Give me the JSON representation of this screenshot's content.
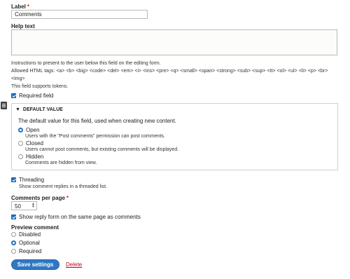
{
  "label_field": {
    "label": "Label",
    "required_marker": "*",
    "value": "Comments"
  },
  "help_text": {
    "label": "Help text",
    "description": "Instructions to present to the user below this field on the editing form.",
    "allowed_tags_line1": "Allowed HTML tags: <a> <b> <big> <code> <del> <em> <i> <ins> <pre> <q> <small> <span> <strong> <sub> <sup> <tt> <ol> <ul> <li> <p> <br>",
    "allowed_tags_line2": "<img>",
    "tokens_note": "This field supports tokens."
  },
  "required_field": {
    "label": "Required field",
    "checked": true
  },
  "default_value": {
    "title": "DEFAULT VALUE",
    "toggle_symbol": "▼",
    "intro": "The default value for this field, used when creating new content.",
    "options": [
      {
        "label": "Open",
        "description": "Users with the \"Post comments\" permission can post comments.",
        "selected": true
      },
      {
        "label": "Closed",
        "description": "Users cannot post comments, but existing comments will be displayed.",
        "selected": false
      },
      {
        "label": "Hidden",
        "description": "Comments are hidden from view.",
        "selected": false
      }
    ]
  },
  "threading": {
    "label": "Threading",
    "checked": true,
    "description": "Show comment replies in a threaded list."
  },
  "comments_per_page": {
    "label": "Comments per page",
    "required_marker": "*",
    "value": "50"
  },
  "reply_form": {
    "label": "Show reply form on the same page as comments",
    "checked": true
  },
  "preview_comment": {
    "label": "Preview comment",
    "options": [
      {
        "label": "Disabled",
        "selected": false
      },
      {
        "label": "Optional",
        "selected": true
      },
      {
        "label": "Required",
        "selected": false
      }
    ]
  },
  "actions": {
    "save_label": "Save settings",
    "delete_label": "Delete"
  },
  "colors": {
    "accent": "#2270c2",
    "required": "#e32700",
    "delete": "#c3001e"
  },
  "icons": {
    "side_toggle": "list-icon",
    "spinner": "spinner-arrows-icon"
  }
}
